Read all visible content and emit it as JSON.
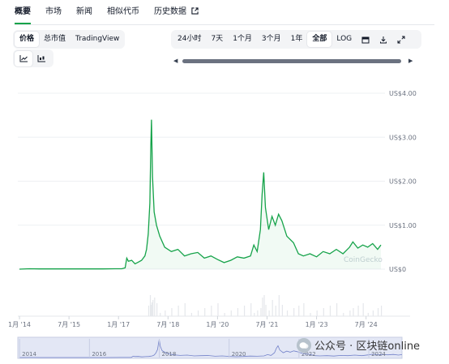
{
  "tabs": {
    "overview": "概要",
    "markets": "市场",
    "news": "新闻",
    "similar": "相似代币",
    "historical": "历史数据"
  },
  "chart_type_buttons": {
    "price": "价格",
    "market_cap": "总市值",
    "tradingview": "TradingView"
  },
  "time_range": {
    "h24": "24小时",
    "d7": "7天",
    "m1": "1个月",
    "m3": "3个月",
    "y1": "1年",
    "all": "全部",
    "log": "LOG",
    "active": "全部"
  },
  "icons": {
    "line_chart": "line-chart-icon",
    "candle_chart": "candlestick-chart-icon",
    "calendar": "calendar-icon",
    "download": "download-icon",
    "fullscreen": "expand-icon",
    "external": "external-link-icon"
  },
  "chart_data": {
    "type": "line",
    "color": "#16a34a",
    "y_ticks": [
      "US$0",
      "US$1.00",
      "US$2.00",
      "US$3.00",
      "US$4.00"
    ],
    "y_tick_values": [
      0,
      1,
      2,
      3,
      4
    ],
    "ylim": [
      0,
      4
    ],
    "x_ticks": [
      "1月 '14",
      "7月 '15",
      "1月 '17",
      "7月 '18",
      "1月 '20",
      "7月 '21",
      "1月 '23",
      "7月 '24"
    ],
    "navigator_ticks": [
      "2014",
      "2016",
      "2018",
      "2020",
      "2022",
      "2024"
    ],
    "series": [
      {
        "values": [
          [
            2014.0,
            0.0
          ],
          [
            2014.3,
            0.01
          ],
          [
            2014.6,
            0.005
          ],
          [
            2015.0,
            0.005
          ],
          [
            2015.5,
            0.005
          ],
          [
            2016.0,
            0.005
          ],
          [
            2016.5,
            0.005
          ],
          [
            2016.9,
            0.01
          ],
          [
            2017.1,
            0.01
          ],
          [
            2017.2,
            0.03
          ],
          [
            2017.25,
            0.25
          ],
          [
            2017.3,
            0.18
          ],
          [
            2017.4,
            0.2
          ],
          [
            2017.5,
            0.12
          ],
          [
            2017.6,
            0.16
          ],
          [
            2017.7,
            0.2
          ],
          [
            2017.8,
            0.3
          ],
          [
            2017.85,
            0.45
          ],
          [
            2017.9,
            0.8
          ],
          [
            2017.95,
            1.5
          ],
          [
            2017.98,
            2.8
          ],
          [
            2018.0,
            3.4
          ],
          [
            2018.03,
            2.1
          ],
          [
            2018.08,
            1.3
          ],
          [
            2018.15,
            1.0
          ],
          [
            2018.25,
            0.75
          ],
          [
            2018.4,
            0.5
          ],
          [
            2018.6,
            0.4
          ],
          [
            2018.8,
            0.45
          ],
          [
            2019.0,
            0.3
          ],
          [
            2019.2,
            0.35
          ],
          [
            2019.4,
            0.38
          ],
          [
            2019.6,
            0.25
          ],
          [
            2019.8,
            0.3
          ],
          [
            2020.0,
            0.22
          ],
          [
            2020.2,
            0.15
          ],
          [
            2020.4,
            0.2
          ],
          [
            2020.6,
            0.28
          ],
          [
            2020.8,
            0.25
          ],
          [
            2021.0,
            0.3
          ],
          [
            2021.1,
            0.55
          ],
          [
            2021.2,
            0.4
          ],
          [
            2021.3,
            0.9
          ],
          [
            2021.35,
            1.7
          ],
          [
            2021.4,
            2.2
          ],
          [
            2021.45,
            1.4
          ],
          [
            2021.55,
            0.9
          ],
          [
            2021.65,
            1.2
          ],
          [
            2021.75,
            1.0
          ],
          [
            2021.85,
            1.25
          ],
          [
            2021.95,
            1.1
          ],
          [
            2022.1,
            0.75
          ],
          [
            2022.3,
            0.6
          ],
          [
            2022.45,
            0.35
          ],
          [
            2022.6,
            0.3
          ],
          [
            2022.8,
            0.35
          ],
          [
            2023.0,
            0.28
          ],
          [
            2023.2,
            0.4
          ],
          [
            2023.4,
            0.35
          ],
          [
            2023.6,
            0.45
          ],
          [
            2023.8,
            0.35
          ],
          [
            2024.0,
            0.5
          ],
          [
            2024.1,
            0.62
          ],
          [
            2024.25,
            0.48
          ],
          [
            2024.4,
            0.55
          ],
          [
            2024.55,
            0.5
          ],
          [
            2024.7,
            0.58
          ],
          [
            2024.85,
            0.45
          ],
          [
            2024.95,
            0.55
          ]
        ]
      }
    ],
    "watermark": "CoinGecko"
  },
  "overlay_watermark": "公众号 · 区块链online"
}
